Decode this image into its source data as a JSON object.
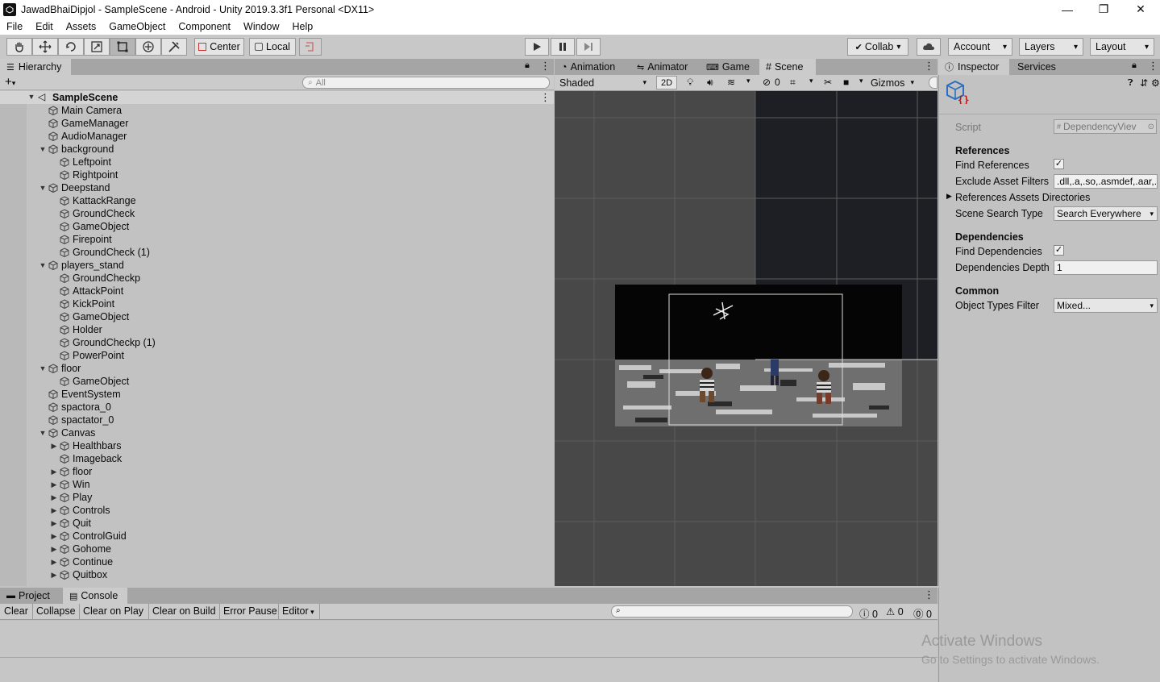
{
  "window": {
    "title": "JawadBhaiDipjol - SampleScene - Android - Unity 2019.3.3f1 Personal <DX11>",
    "minimize": "—",
    "restore": "❐",
    "close": "✕"
  },
  "menu": [
    "File",
    "Edit",
    "Assets",
    "GameObject",
    "Component",
    "Window",
    "Help"
  ],
  "toolbar": {
    "center_label": "Center",
    "local_label": "Local",
    "collab_label": "Collab",
    "account_label": "Account",
    "layers_label": "Layers",
    "layout_label": "Layout"
  },
  "hierarchy": {
    "tab_label": "Hierarchy",
    "search_placeholder": "All",
    "scene_name": "SampleScene",
    "items": [
      {
        "label": "Main Camera",
        "depth": 1,
        "arrow": ""
      },
      {
        "label": "GameManager",
        "depth": 1,
        "arrow": ""
      },
      {
        "label": "AudioManager",
        "depth": 1,
        "arrow": ""
      },
      {
        "label": "background",
        "depth": 1,
        "arrow": "open"
      },
      {
        "label": "Leftpoint",
        "depth": 2,
        "arrow": ""
      },
      {
        "label": "Rightpoint",
        "depth": 2,
        "arrow": ""
      },
      {
        "label": "Deepstand",
        "depth": 1,
        "arrow": "open"
      },
      {
        "label": "KattackRange",
        "depth": 2,
        "arrow": ""
      },
      {
        "label": "GroundCheck",
        "depth": 2,
        "arrow": ""
      },
      {
        "label": "GameObject",
        "depth": 2,
        "arrow": ""
      },
      {
        "label": "Firepoint",
        "depth": 2,
        "arrow": ""
      },
      {
        "label": "GroundCheck (1)",
        "depth": 2,
        "arrow": ""
      },
      {
        "label": "players_stand",
        "depth": 1,
        "arrow": "open"
      },
      {
        "label": "GroundCheckp",
        "depth": 2,
        "arrow": ""
      },
      {
        "label": "AttackPoint",
        "depth": 2,
        "arrow": ""
      },
      {
        "label": "KickPoint",
        "depth": 2,
        "arrow": ""
      },
      {
        "label": "GameObject",
        "depth": 2,
        "arrow": ""
      },
      {
        "label": "Holder",
        "depth": 2,
        "arrow": ""
      },
      {
        "label": "GroundCheckp (1)",
        "depth": 2,
        "arrow": ""
      },
      {
        "label": "PowerPoint",
        "depth": 2,
        "arrow": ""
      },
      {
        "label": "floor",
        "depth": 1,
        "arrow": "open"
      },
      {
        "label": "GameObject",
        "depth": 2,
        "arrow": ""
      },
      {
        "label": "EventSystem",
        "depth": 1,
        "arrow": ""
      },
      {
        "label": "spactora_0",
        "depth": 1,
        "arrow": ""
      },
      {
        "label": "spactator_0",
        "depth": 1,
        "arrow": ""
      },
      {
        "label": "Canvas",
        "depth": 1,
        "arrow": "open"
      },
      {
        "label": "Healthbars",
        "depth": 2,
        "arrow": "closed"
      },
      {
        "label": "Imageback",
        "depth": 2,
        "arrow": ""
      },
      {
        "label": "floor",
        "depth": 2,
        "arrow": "closed"
      },
      {
        "label": "Win",
        "depth": 2,
        "arrow": "closed"
      },
      {
        "label": "Play",
        "depth": 2,
        "arrow": "closed"
      },
      {
        "label": "Controls",
        "depth": 2,
        "arrow": "closed"
      },
      {
        "label": "Quit",
        "depth": 2,
        "arrow": "closed"
      },
      {
        "label": "ControlGuid",
        "depth": 2,
        "arrow": "closed"
      },
      {
        "label": "Gohome",
        "depth": 2,
        "arrow": "closed"
      },
      {
        "label": "Continue",
        "depth": 2,
        "arrow": "closed"
      },
      {
        "label": "Quitbox",
        "depth": 2,
        "arrow": "closed"
      }
    ]
  },
  "scene": {
    "tabs": [
      "Animation",
      "Animator",
      "Game",
      "Scene"
    ],
    "active_tab": "Scene",
    "shading_mode": "Shaded",
    "mode_2d": "2D",
    "hidden_count": "0",
    "gizmos_label": "Gizmos"
  },
  "inspector": {
    "tabs": [
      "Inspector",
      "Services"
    ],
    "script_label": "Script",
    "script_value": "DependencyViev",
    "references_header": "References",
    "find_references_label": "Find References",
    "find_references_checked": true,
    "exclude_filters_label": "Exclude Asset Filters",
    "exclude_filters_value": ".dll,.a,.so,.asmdef,.aar,.",
    "ref_dirs_label": "References Assets Directories",
    "scene_search_label": "Scene Search Type",
    "scene_search_value": "Search Everywhere",
    "dependencies_header": "Dependencies",
    "find_dependencies_label": "Find Dependencies",
    "find_dependencies_checked": true,
    "dependencies_depth_label": "Dependencies Depth",
    "dependencies_depth_value": "1",
    "common_header": "Common",
    "object_types_label": "Object Types Filter",
    "object_types_value": "Mixed..."
  },
  "console": {
    "tabs": [
      "Project",
      "Console"
    ],
    "active_tab": "Console",
    "buttons": [
      "Clear",
      "Collapse",
      "Clear on Play",
      "Clear on Build",
      "Error Pause",
      "Editor"
    ],
    "info_count": "0",
    "warning_count": "0",
    "error_count": "0"
  },
  "watermark": {
    "line1": "Activate Windows",
    "line2": "Go to Settings to activate Windows."
  }
}
